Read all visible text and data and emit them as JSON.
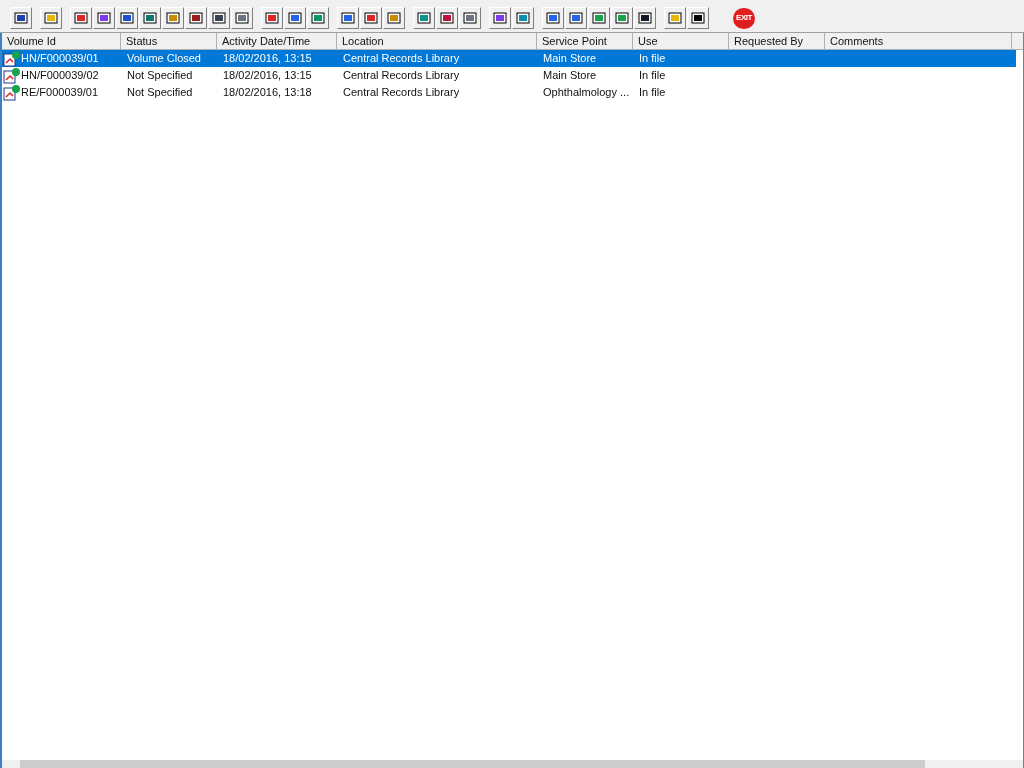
{
  "toolbar": {
    "exit_label": "EXIT"
  },
  "table": {
    "columns": [
      "Volume Id",
      "Status",
      "Activity Date/Time",
      "Location",
      "Service Point",
      "Use",
      "Requested By",
      "Comments"
    ],
    "rows": [
      {
        "selected": true,
        "cells": [
          "HN/F000039/01",
          "Volume Closed",
          "18/02/2016, 13:15",
          "Central Records Library",
          "Main Store",
          "In file",
          "",
          ""
        ]
      },
      {
        "selected": false,
        "cells": [
          "HN/F000039/02",
          "Not Specified",
          "18/02/2016, 13:15",
          "Central Records Library",
          "Main Store",
          "In file",
          "",
          ""
        ]
      },
      {
        "selected": false,
        "cells": [
          "RE/F000039/01",
          "Not Specified",
          "18/02/2016, 13:18",
          "Central Records Library",
          "Ophthalmology ...",
          "In file",
          "",
          ""
        ]
      }
    ]
  }
}
